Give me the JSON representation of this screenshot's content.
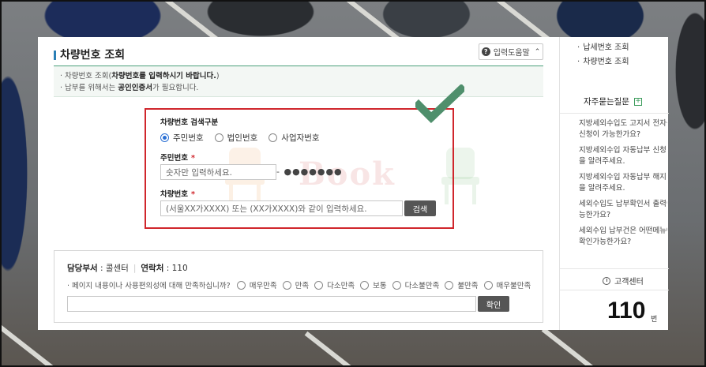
{
  "main": {
    "title": "차량번호 조회",
    "help_label": "입력도움말",
    "notice_line1_pre": "· 차량번호 조회(",
    "notice_line1_bold": "차량번호를 입력하시기 바랍니다.",
    "notice_line1_post": ")",
    "notice_line2_pre": "· 납부를 위해서는 ",
    "notice_line2_bold": "공인인증서",
    "notice_line2_post": "가 필요합니다."
  },
  "search": {
    "type_label": "차량번호 검색구분",
    "options": [
      "주민번호",
      "법인번호",
      "사업자번호"
    ],
    "selected": "주민번호",
    "rrn_label": "주민번호",
    "rrn_placeholder": "숫자만 입력하세요.",
    "rrn_masked": "- ●●●●●●●",
    "car_label": "차량번호",
    "car_placeholder": "(서울XX가XXXX) 또는 (XX가XXXX)와 같이 입력하세요.",
    "search_button": "검색",
    "required_mark": "*"
  },
  "watermark": "Book",
  "survey": {
    "dept_label": "담당부서",
    "dept_value": "콜센터",
    "contact_label": "연락처",
    "contact_value": "110",
    "question": "· 페이지 내용이나 사용편의성에 대해 만족하십니까?",
    "options": [
      "매우만족",
      "만족",
      "다소만족",
      "보통",
      "다소불만족",
      "불만족",
      "매우불만족"
    ],
    "confirm_button": "확인"
  },
  "sidebar": {
    "links": [
      "납세번호 조회",
      "차량번호 조회"
    ],
    "faq_title": "자주묻는질문",
    "faq_items": [
      [
        "지방세외수입도 고지서 전자송",
        "신청이 가능한가요?"
      ],
      [
        "지방세외수입 자동납부 신청 방",
        "을 알려주세요."
      ],
      [
        "지방세외수입 자동납부 해지 방",
        "을 알려주세요."
      ],
      [
        "세외수입도 납부확인서 출력이",
        "능한가요?"
      ],
      [
        "세외수입 납부건은 어떤메뉴에",
        "확인가능한가요?"
      ]
    ],
    "cs_title": "고객센터",
    "cs_number": "110",
    "cs_unit": "번"
  },
  "colors": {
    "highlight_border": "#d0262c",
    "check_mark": "#4f8f6c",
    "accent_green": "#4aa07a"
  }
}
